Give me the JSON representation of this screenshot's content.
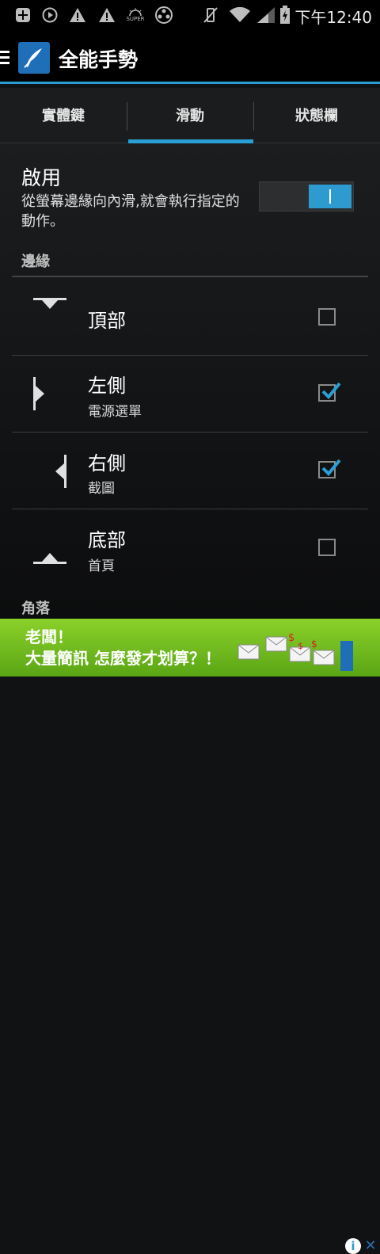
{
  "status_bar": {
    "time": "下午12:40",
    "icons": [
      "plus-box-icon",
      "play-circle-icon",
      "warning-icon",
      "warning-icon",
      "super-sun-icon",
      "film-reel-icon",
      "vibrate-off-icon",
      "wifi-icon",
      "signal-icon",
      "battery-charging-icon"
    ],
    "super_label": "SUPER"
  },
  "action_bar": {
    "title": "全能手勢"
  },
  "tabs": [
    {
      "label": "實體鍵",
      "selected": false
    },
    {
      "label": "滑動",
      "selected": true
    },
    {
      "label": "狀態欄",
      "selected": false
    }
  ],
  "enable": {
    "title": "啟用",
    "description": "從螢幕邊緣向內滑,就會執行指定的動作。",
    "on": true
  },
  "sections": {
    "edges": "邊緣",
    "corners": "角落"
  },
  "edges": [
    {
      "title": "頂部",
      "subtitle": "",
      "checked": false,
      "icon": "top-edge-icon"
    },
    {
      "title": "左側",
      "subtitle": "電源選單",
      "checked": true,
      "icon": "left-edge-icon"
    },
    {
      "title": "右側",
      "subtitle": "截圖",
      "checked": true,
      "icon": "right-edge-icon"
    },
    {
      "title": "底部",
      "subtitle": "首頁",
      "checked": false,
      "icon": "bottom-edge-icon"
    }
  ],
  "ad": {
    "line1": "老闆！",
    "line2": "大量簡訊 怎麼發才划算？！",
    "info_icon": "info-icon",
    "close_icon": "close-icon"
  },
  "colors": {
    "accent": "#2a9fd6",
    "ad_green": "#6cba1c",
    "background": "#101214"
  }
}
